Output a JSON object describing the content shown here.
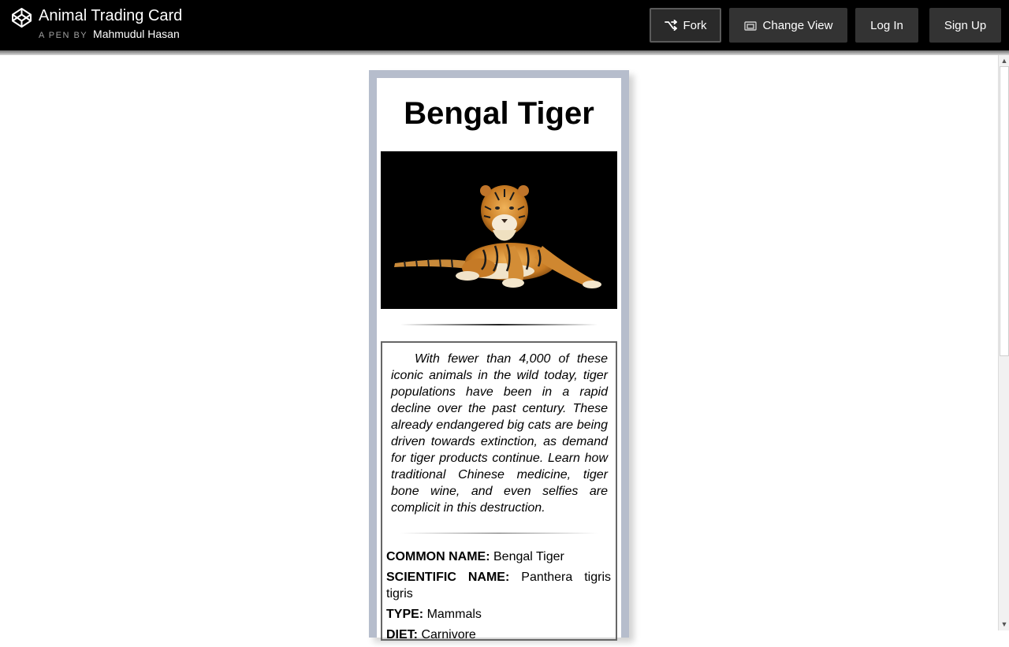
{
  "header": {
    "title": "Animal Trading Card",
    "pen_by_label": "A PEN BY",
    "author": "Mahmudul Hasan",
    "buttons": {
      "fork": "Fork",
      "change_view": "Change View",
      "log_in": "Log In",
      "sign_up": "Sign Up"
    }
  },
  "card": {
    "animal_name": "Bengal Tiger",
    "description": "With fewer than 4,000 of these iconic animals in the wild today, tiger populations have been in a rapid decline over the past century. These already endangered big cats are being driven towards extinction, as demand for tiger products continue. Learn how traditional Chinese medicine, tiger bone wine, and even selfies are complicit in this destruction.",
    "facts": [
      {
        "label": "COMMON NAME:",
        "value": "Bengal Tiger"
      },
      {
        "label": "SCIENTIFIC NAME:",
        "value": "Panthera tigris tigris"
      },
      {
        "label": "TYPE:",
        "value": "Mammals"
      },
      {
        "label": "DIET:",
        "value": "Carnivore"
      }
    ]
  },
  "colors": {
    "header_bg": "#000000",
    "button_bg": "#333333",
    "card_border": "#b6bdcc"
  },
  "icons": [
    "codepen-logo-icon",
    "fork-icon",
    "change-view-icon"
  ]
}
